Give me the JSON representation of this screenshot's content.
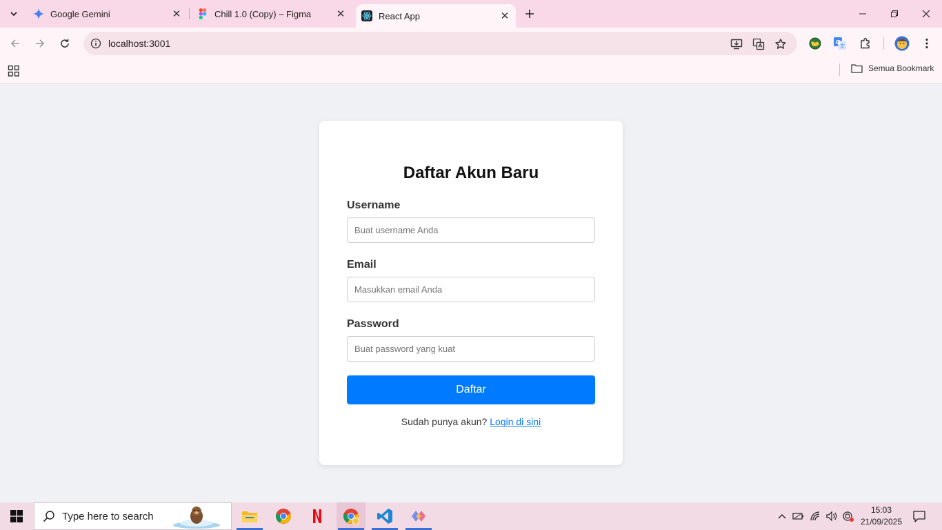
{
  "browser": {
    "tabs": [
      {
        "title": "Google Gemini",
        "active": false
      },
      {
        "title": "Chill 1.0 (Copy) – Figma",
        "active": false
      },
      {
        "title": "React App",
        "active": true
      }
    ],
    "address": "localhost:3001",
    "bookmarks_all_label": "Semua Bookmark"
  },
  "form": {
    "title": "Daftar Akun Baru",
    "fields": [
      {
        "label": "Username",
        "placeholder": "Buat username Anda",
        "value": ""
      },
      {
        "label": "Email",
        "placeholder": "Masukkan email Anda",
        "value": ""
      },
      {
        "label": "Password",
        "placeholder": "Buat password yang kuat",
        "value": ""
      }
    ],
    "submit_label": "Daftar",
    "footer_text": "Sudah punya akun? ",
    "footer_link": "Login di sini",
    "accent_color": "#007bff"
  },
  "taskbar": {
    "search_placeholder": "Type here to search",
    "apps": [
      "file-explorer-icon",
      "chrome-icon",
      "netflix-icon",
      "chrome-profile-icon",
      "vscode-icon",
      "git-icon"
    ],
    "time": "15:03",
    "date": "21/09/2025"
  }
}
